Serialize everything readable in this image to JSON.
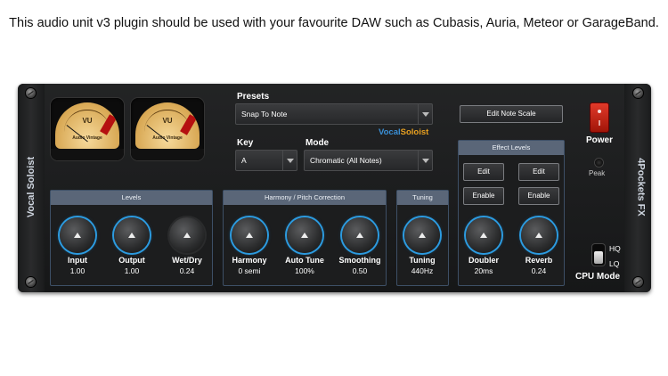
{
  "caption": "This audio unit v3 plugin should be used with your favourite DAW such as Cubasis, Auria, Meteor or GarageBand.",
  "plugin": {
    "left_side_text": "Vocal Soloist",
    "right_side_text": "4Pockets FX",
    "brand_part1": "Vocal",
    "brand_part2": "Soloist",
    "brand_color1": "#3a8fd6",
    "brand_color2": "#e8a020"
  },
  "meters": [
    {
      "label": "VU",
      "brand": "Audio Vintage"
    },
    {
      "label": "VU",
      "brand": "Audio Vintage"
    }
  ],
  "presets": {
    "label": "Presets",
    "value": "Snap To Note"
  },
  "key": {
    "label": "Key",
    "value": "A"
  },
  "mode": {
    "label": "Mode",
    "value": "Chromatic (All Notes)"
  },
  "edit_note_scale": "Edit Note Scale",
  "levels": {
    "title": "Levels",
    "knobs": [
      {
        "name": "Input",
        "value": "1.00"
      },
      {
        "name": "Output",
        "value": "1.00"
      },
      {
        "name": "Wet/Dry",
        "value": "0.24"
      }
    ]
  },
  "harmony": {
    "title": "Harmony / Pitch Correction",
    "knobs": [
      {
        "name": "Harmony",
        "value": "0 semi"
      },
      {
        "name": "Auto Tune",
        "value": "100%"
      },
      {
        "name": "Smoothing",
        "value": "0.50"
      }
    ]
  },
  "tuning": {
    "title": "Tuning",
    "knob": {
      "name": "Tuning",
      "value": "440Hz"
    }
  },
  "effects": {
    "title": "Effect Levels",
    "edit_label": "Edit",
    "enable_label": "Enable",
    "knobs": [
      {
        "name": "Doubler",
        "value": "20ms"
      },
      {
        "name": "Reverb",
        "value": "0.24"
      }
    ]
  },
  "power": {
    "label": "Power",
    "peak_label": "Peak"
  },
  "cpu": {
    "hq": "HQ",
    "lq": "LQ",
    "label": "CPU Mode"
  },
  "colors": {
    "accent_ring": "#2c9be0",
    "panel_header": "#5a6678",
    "power_red": "#e23a2a"
  }
}
